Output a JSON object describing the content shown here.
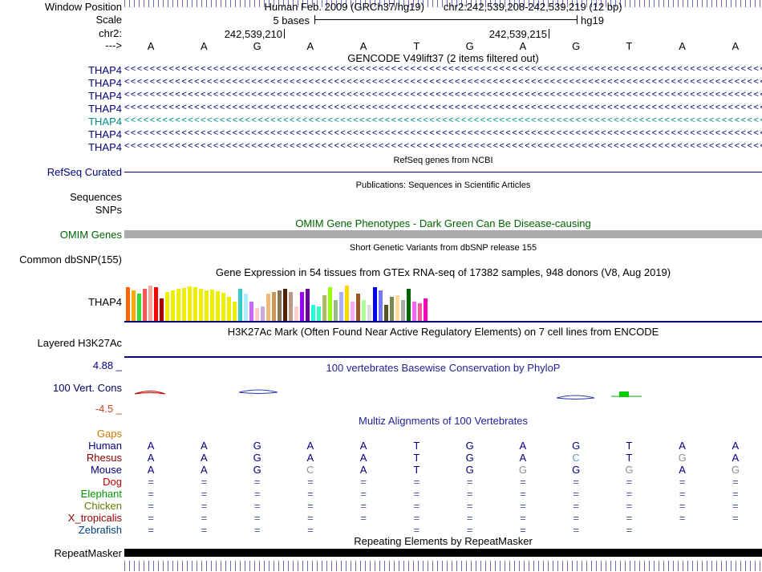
{
  "header": {
    "window_position_label": "Window Position",
    "assembly_line": "Human Feb. 2009 (GRCh37/hg19)",
    "position_line": "chr2:242,539,208-242,539,219 (12 bp)",
    "scale_label": "Scale",
    "scale_value": "5 bases",
    "assembly_tag": "hg19",
    "chrom_label": "chr2:",
    "coord_left": "242,539,210",
    "coord_right": "242,539,215",
    "strand_label": "--->",
    "bases": [
      "A",
      "A",
      "G",
      "A",
      "A",
      "T",
      "G",
      "A",
      "G",
      "T",
      "A",
      "A"
    ]
  },
  "gencode": {
    "title": "GENCODE V49lift37 (2 items filtered out)",
    "arrow_glyph": "<",
    "transcripts": [
      {
        "label": "THAP4",
        "color": "#000080"
      },
      {
        "label": "THAP4",
        "color": "#000080"
      },
      {
        "label": "THAP4",
        "color": "#000080"
      },
      {
        "label": "THAP4",
        "color": "#000080"
      },
      {
        "label": "THAP4",
        "color": "#008B8B"
      },
      {
        "label": "THAP4",
        "color": "#000080"
      },
      {
        "label": "THAP4",
        "color": "#000080"
      }
    ]
  },
  "refseq": {
    "note": "RefSeq genes from NCBI",
    "label": "RefSeq Curated",
    "label_color": "#000080"
  },
  "publications": {
    "note": "Publications: Sequences in Scientific Articles",
    "sequences_label": "Sequences",
    "snps_label": "SNPs"
  },
  "omim": {
    "title": "OMIM Gene Phenotypes - Dark Green Can Be Disease-causing",
    "label": "OMIM Genes",
    "title_color": "#006400",
    "bar_color": "#ABABAB"
  },
  "dbsnp": {
    "note": "Short Genetic Variants from dbSNP release 155",
    "label": "Common dbSNP(155)"
  },
  "gtex": {
    "title": "Gene Expression in 54 tissues from GTEx RNA-seq of 17382 samples, 948 donors (V8, Aug 2019)",
    "label": "THAP4",
    "bars": {
      "colors": [
        "#FF6600",
        "#FFAA00",
        "#33DD33",
        "#FF5555",
        "#FFAA99",
        "#FF0000",
        "#AA0000",
        "#EEEE00",
        "#EEEE00",
        "#EEEE00",
        "#EEEE00",
        "#EEEE00",
        "#EEEE00",
        "#EEEE00",
        "#EEEE00",
        "#EEEE00",
        "#EEEE00",
        "#EEEE00",
        "#EEEE00",
        "#EEEE00",
        "#33CCCC",
        "#AAEEFF",
        "#CC66FF",
        "#FFCCCC",
        "#CCAADD",
        "#EEBB77",
        "#CC9955",
        "#8B7355",
        "#552200",
        "#BB9988",
        "#FFCCCC",
        "#9900FF",
        "#660099",
        "#22FFDD",
        "#33FFC2",
        "#AABB66",
        "#99FF00",
        "#99BB88",
        "#AAAAFF",
        "#FFD700",
        "#FFAAFF",
        "#995522",
        "#AAFF99",
        "#DDDDDD",
        "#0000FF",
        "#7777FF",
        "#555522",
        "#778855",
        "#FFDD99",
        "#AAAAAA",
        "#006600",
        "#FF66FF",
        "#FF5599",
        "#FF00BB"
      ],
      "heights": [
        42,
        38,
        34,
        40,
        44,
        42,
        28,
        36,
        38,
        40,
        41,
        43,
        42,
        40,
        38,
        39,
        37,
        35,
        30,
        24,
        40,
        34,
        24,
        16,
        18,
        34,
        36,
        38,
        40,
        36,
        18,
        36,
        40,
        20,
        18,
        32,
        42,
        26,
        36,
        44,
        24,
        34,
        26,
        20,
        42,
        38,
        20,
        30,
        32,
        26,
        40,
        24,
        22,
        28
      ]
    }
  },
  "h3k27ac": {
    "title": "H3K27Ac Mark (Often Found Near Active Regulatory Elements) on 7 cell lines from ENCODE",
    "label": "Layered H3K27Ac"
  },
  "conservation": {
    "title": "100 vertebrates Basewise Conservation by PhyloP",
    "label": "100 Vert. Cons",
    "max": "4.88 _",
    "min": "-4.5 _",
    "title_color": "#222299",
    "max_color": "#000088",
    "min_color": "#CC4422"
  },
  "multiz": {
    "title": "Multiz Alignments of 100 Vertebrates",
    "title_color": "#222299",
    "gaps_label": "Gaps",
    "gaps_color": "#CC7700",
    "rows": [
      {
        "name": "Human",
        "color": "#000080",
        "cell_color": "#000080",
        "cells": [
          "A",
          "A",
          "G",
          "A",
          "A",
          "T",
          "G",
          "A",
          "G",
          "T",
          "A",
          "A"
        ],
        "cell_colors": {}
      },
      {
        "name": "Rhesus",
        "color": "#8B0000",
        "cell_color": "#000080",
        "cells": [
          "A",
          "A",
          "G",
          "A",
          "A",
          "T",
          "G",
          "A",
          "C",
          "T",
          "G",
          "A"
        ],
        "cell_colors": {
          "8": "#6699CC",
          "10": "#909090"
        }
      },
      {
        "name": "Mouse",
        "color": "#000080",
        "cell_color": "#000080",
        "cells": [
          "A",
          "A",
          "G",
          "C",
          "A",
          "T",
          "G",
          "G",
          "G",
          "G",
          "A",
          "G"
        ],
        "cell_colors": {
          "3": "#909090",
          "7": "#909090",
          "9": "#909090",
          "11": "#909090"
        }
      },
      {
        "name": "Dog",
        "color": "#CC0000",
        "cell_color": "#445599",
        "cells": [
          "=",
          "=",
          "=",
          "=",
          "=",
          "=",
          "=",
          "=",
          "=",
          "=",
          "=",
          "="
        ],
        "cell_colors": {}
      },
      {
        "name": "Elephant",
        "color": "#009900",
        "cell_color": "#445599",
        "cells": [
          "=",
          "=",
          "=",
          "=",
          "=",
          "=",
          "=",
          "=",
          "=",
          "=",
          "=",
          "="
        ],
        "cell_colors": {}
      },
      {
        "name": "Chicken",
        "color": "#6B7700",
        "cell_color": "#445599",
        "cells": [
          "=",
          "=",
          "=",
          "=",
          "=",
          "=",
          "=",
          "=",
          "=",
          "=",
          "=",
          "="
        ],
        "cell_colors": {}
      },
      {
        "name": "X_tropicalis",
        "color": "#990000",
        "cell_color": "#445599",
        "cells": [
          "=",
          "=",
          "=",
          "=",
          "=",
          "=",
          "=",
          "=",
          "=",
          "=",
          "=",
          "="
        ],
        "cell_colors": {}
      },
      {
        "name": "Zebrafish",
        "color": "#004080",
        "cell_color": "#445599",
        "cells": [
          "=",
          "=",
          "=",
          "=",
          "",
          "=",
          "=",
          "=",
          "=",
          "=",
          "",
          ""
        ],
        "cell_colors": {}
      }
    ]
  },
  "repeatmasker": {
    "title": "Repeating Elements by RepeatMasker",
    "label": "RepeatMasker",
    "bar_color": "#000000"
  }
}
